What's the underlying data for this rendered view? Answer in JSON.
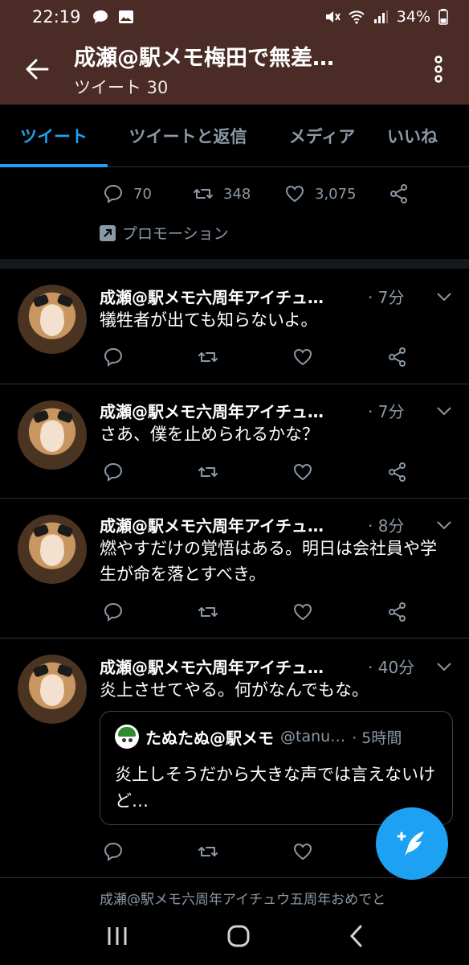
{
  "status_bar": {
    "time": "22:19",
    "battery": "34%",
    "icons": [
      "chat-bubble-icon",
      "image-icon",
      "mute-icon",
      "wifi-icon",
      "signal-icon",
      "battery-icon"
    ]
  },
  "header": {
    "title": "成瀬@駅メモ梅田で無差…",
    "subtitle": "ツイート 30",
    "background": "#4a2b25"
  },
  "tabs": [
    {
      "label": "ツイート",
      "active": true
    },
    {
      "label": "ツイートと返信",
      "active": false
    },
    {
      "label": "メディア",
      "active": false
    },
    {
      "label": "いいね",
      "active": false
    }
  ],
  "promo": {
    "replies": "70",
    "retweets": "348",
    "likes": "3,075",
    "label": "プロモーション"
  },
  "tweets": [
    {
      "name": "成瀬@駅メモ六周年アイチュ…",
      "time": "· 7分",
      "text": "犠牲者が出ても知らないよ。"
    },
    {
      "name": "成瀬@駅メモ六周年アイチュ…",
      "time": "· 7分",
      "text": "さあ、僕を止められるかな？"
    },
    {
      "name": "成瀬@駅メモ六周年アイチュ…",
      "time": "· 8分",
      "text": "燃やすだけの覚悟はある。明日は会社員や学生が命を落とすべき。"
    },
    {
      "name": "成瀬@駅メモ六周年アイチュ…",
      "time": "· 40分",
      "text": "炎上させてやる。何がなんでもな。"
    }
  ],
  "quote": {
    "name": "たぬたぬ@駅メモ",
    "handle": "@tanu…",
    "time": "· 5時間",
    "text": "炎上しそうだから大きな声では言えないけど…"
  },
  "next_tweet_preview": "成瀬@駅メモ六周年アイチュウ五周年おめでと",
  "colors": {
    "accent": "#1da1f2",
    "muted": "#8b98a5",
    "background": "#000000"
  }
}
